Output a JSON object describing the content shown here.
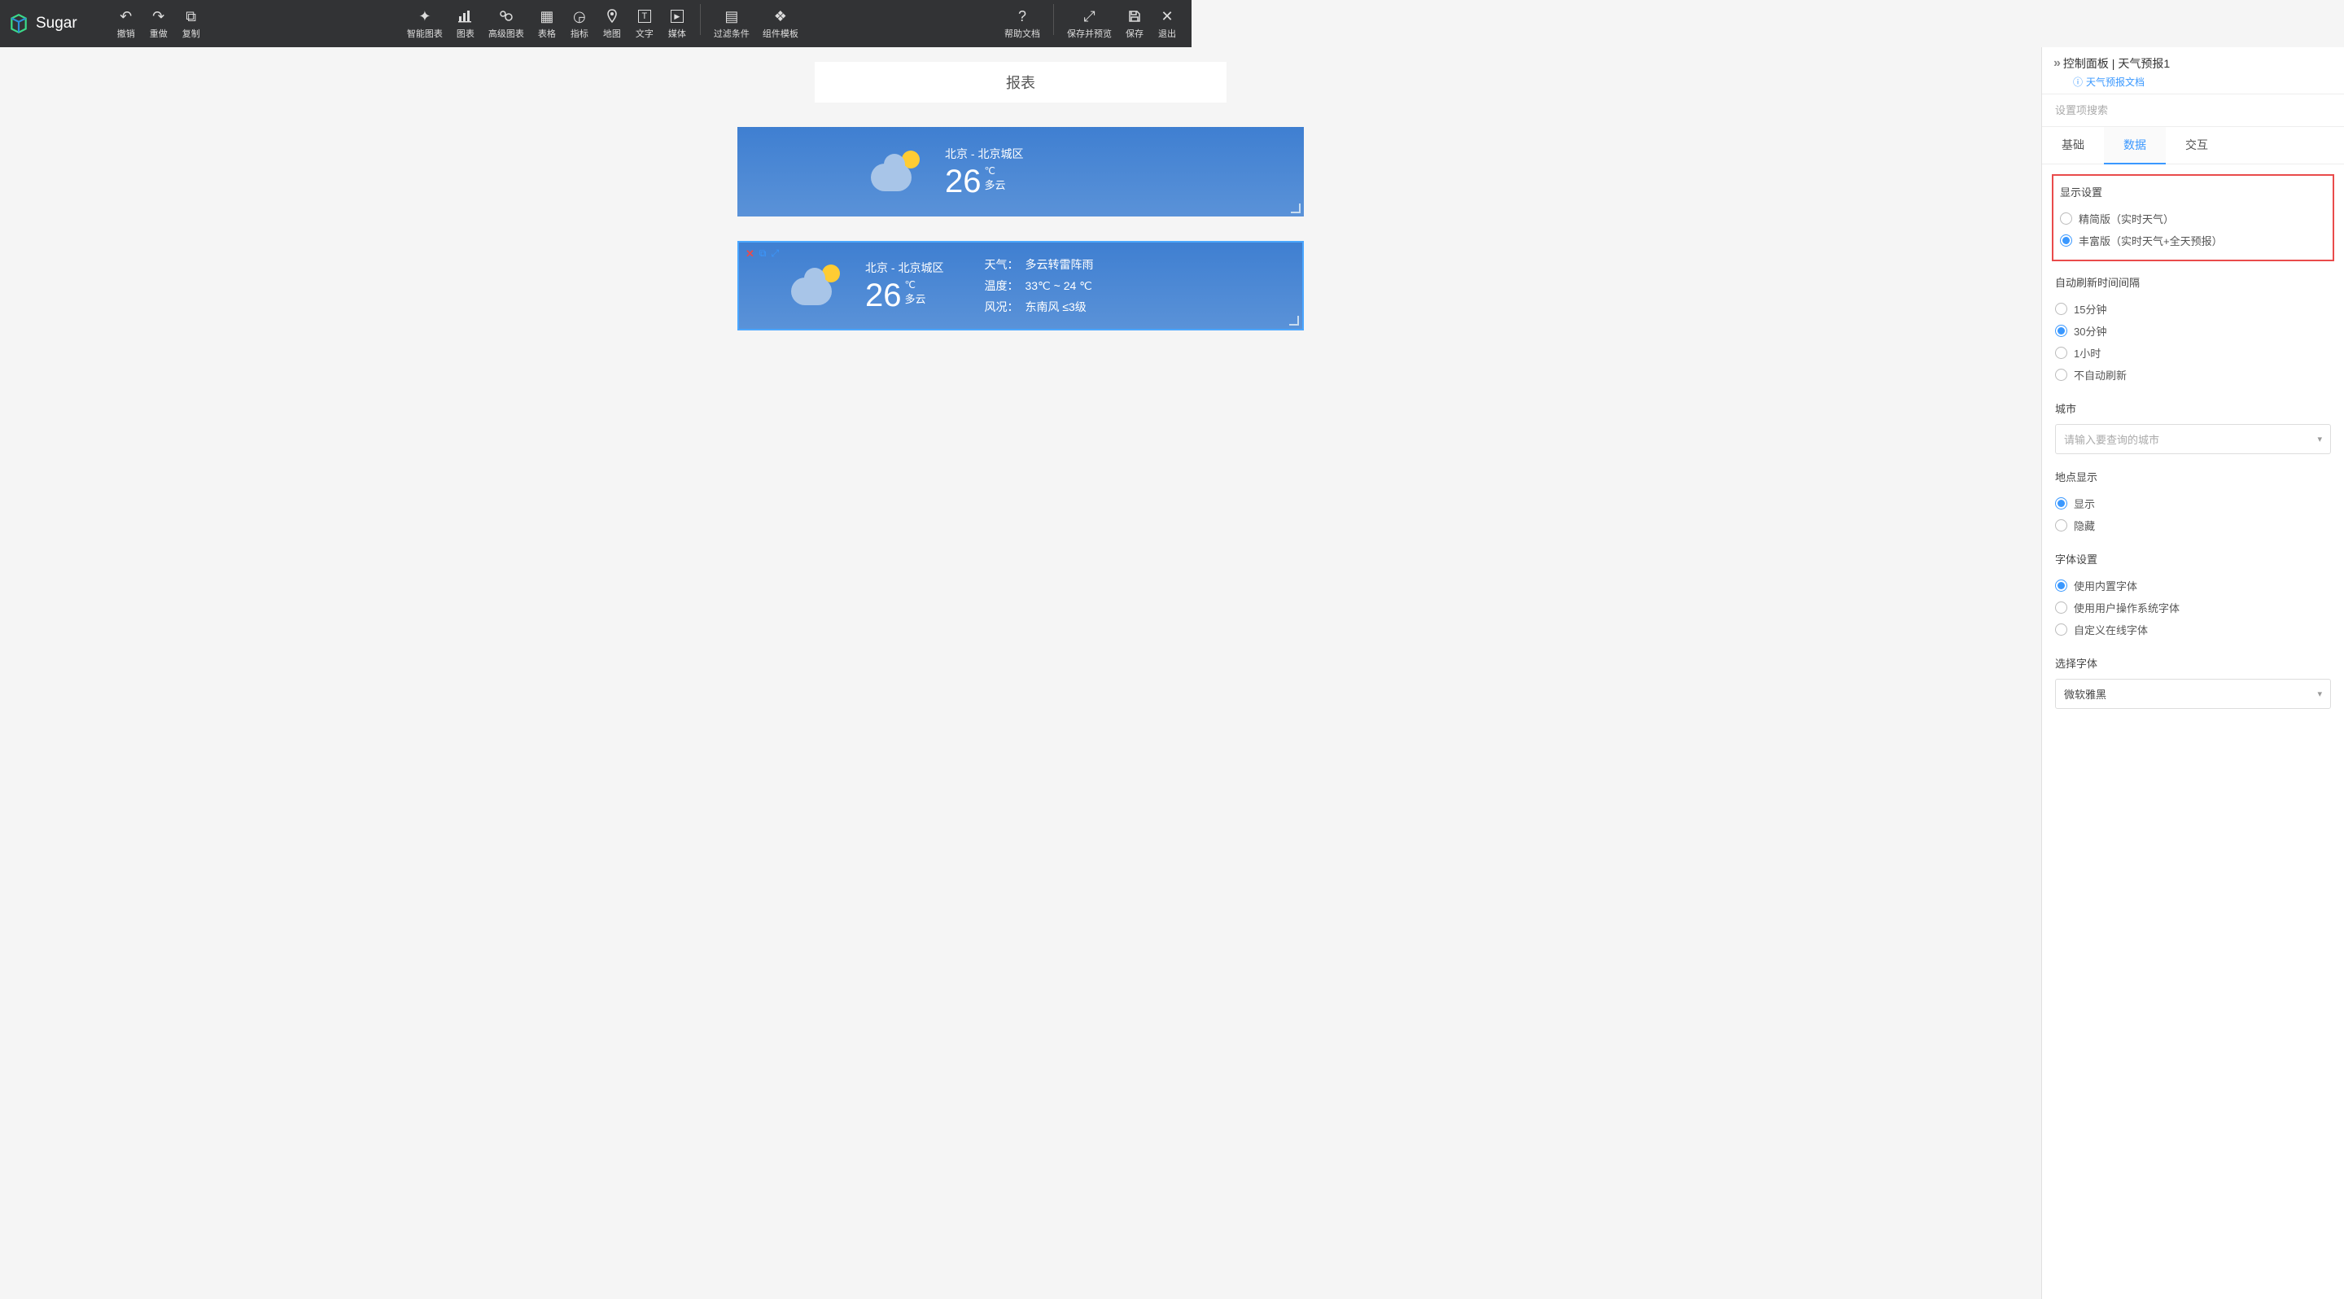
{
  "brand": "Sugar",
  "toolbar": {
    "undo": "撤销",
    "redo": "重做",
    "copy": "复制",
    "smartChart": "智能图表",
    "chart": "图表",
    "advChart": "高级图表",
    "table": "表格",
    "metric": "指标",
    "map": "地图",
    "text": "文字",
    "media": "媒体",
    "filter": "过滤条件",
    "compTpl": "组件模板",
    "help": "帮助文档",
    "savePreview": "保存并预览",
    "save": "保存",
    "exit": "退出"
  },
  "report": {
    "title": "报表"
  },
  "card1": {
    "location": "北京 - 北京城区",
    "temp": "26",
    "unit": "℃",
    "condition": "多云"
  },
  "card2": {
    "location": "北京 - 北京城区",
    "temp": "26",
    "unit": "℃",
    "condition": "多云",
    "details": {
      "weatherLbl": "天气：",
      "weather": "多云转雷阵雨",
      "tempLbl": "温度：",
      "temp": "33℃ ~ 24 ℃",
      "windLbl": "风况：",
      "wind": "东南风 ≤3级"
    }
  },
  "panel": {
    "title": "控制面板 | 天气预报1",
    "docLink": "天气预报文档",
    "searchPlaceholder": "设置项搜索",
    "tabs": {
      "basic": "基础",
      "data": "数据",
      "interact": "交互"
    },
    "display": {
      "title": "显示设置",
      "simple": "精简版（实时天气）",
      "rich": "丰富版（实时天气+全天预报）"
    },
    "refresh": {
      "title": "自动刷新时间间隔",
      "m15": "15分钟",
      "m30": "30分钟",
      "h1": "1小时",
      "none": "不自动刷新"
    },
    "city": {
      "title": "城市",
      "placeholder": "请输入要查询的城市"
    },
    "locationDisplay": {
      "title": "地点显示",
      "show": "显示",
      "hide": "隐藏"
    },
    "font": {
      "title": "字体设置",
      "builtin": "使用内置字体",
      "system": "使用用户操作系统字体",
      "custom": "自定义在线字体"
    },
    "fontSelect": {
      "title": "选择字体",
      "value": "微软雅黑"
    }
  }
}
